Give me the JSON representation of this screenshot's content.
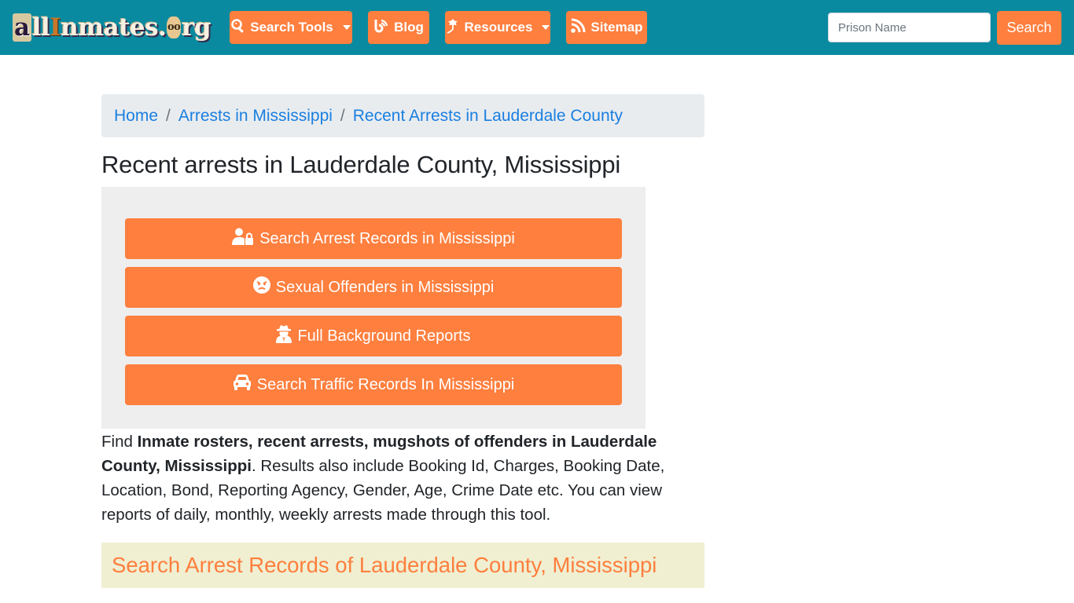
{
  "navbar": {
    "logo": {
      "part_a": "a",
      "part_ll": "ll",
      "part_i": "I",
      "part_nmates": "nmates.",
      "part_o": "oo",
      "part_rg": "rg",
      "alt": "allinmates.org"
    },
    "items": [
      {
        "label": "Search Tools",
        "icon": "search-icon",
        "dropdown": true
      },
      {
        "label": "Blog",
        "icon": "blog-icon",
        "dropdown": false
      },
      {
        "label": "Resources",
        "icon": "leaf-icon",
        "dropdown": true
      },
      {
        "label": "Sitemap",
        "icon": "rss-icon",
        "dropdown": false
      }
    ],
    "search": {
      "placeholder": "Prison Name",
      "value": "",
      "button_label": "Search"
    }
  },
  "breadcrumb": [
    {
      "label": "Home"
    },
    {
      "label": "Arrests in Mississippi"
    },
    {
      "label": "Recent Arrests in Lauderdale County"
    }
  ],
  "breadcrumb_separator": "/",
  "page_title": "Recent arrests in Lauderdale County, Mississippi",
  "action_buttons": [
    {
      "label": "Search Arrest Records in Mississippi",
      "icon": "user-lock-icon"
    },
    {
      "label": "Sexual Offenders in Mississippi",
      "icon": "angry-face-icon"
    },
    {
      "label": "Full Background Reports",
      "icon": "user-secret-icon"
    },
    {
      "label": "Search Traffic Records In Mississippi",
      "icon": "car-icon"
    }
  ],
  "description": {
    "prefix": "Find ",
    "bold": "Inmate rosters, recent arrests, mugshots of offenders in Lauderdale County, Mississippi",
    "suffix": ". Results also include Booking Id, Charges, Booking Date, Location, Bond, Reporting Agency, Gender, Age, Crime Date etc. You can view reports of daily, monthly, weekly arrests made through this tool."
  },
  "section_heading": "Search Arrest Records of Lauderdale County, Mississippi",
  "colors": {
    "navbar_bg": "#0a8aa0",
    "accent": "#fe7f3e",
    "link": "#1a7fe0",
    "breadcrumb_bg": "#e9ecef",
    "panel_bg": "#eeeeee",
    "section_bg": "#f0efd2"
  }
}
